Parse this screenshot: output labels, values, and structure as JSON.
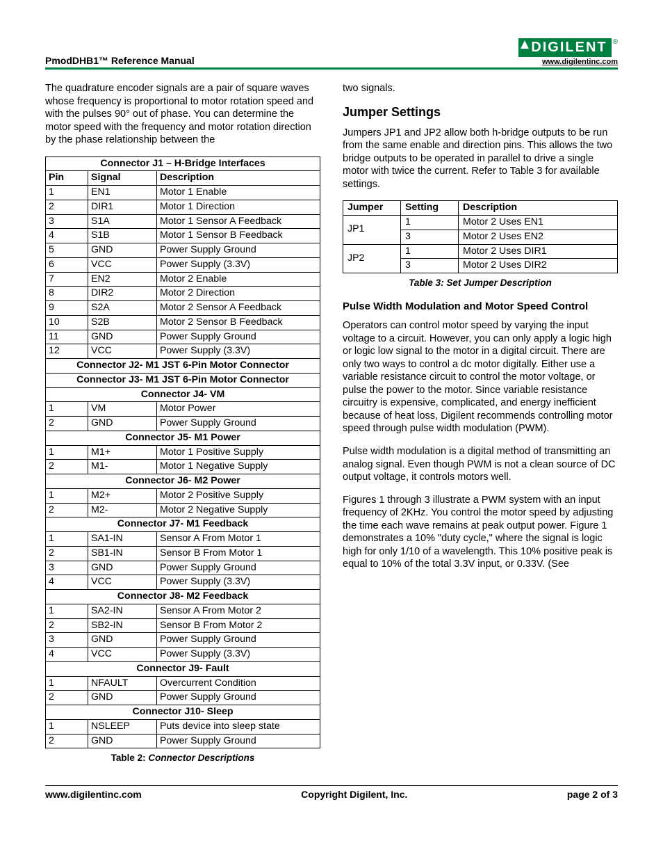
{
  "header": {
    "title": "PmodDHB1™ Reference Manual",
    "logo_text": "DIGILENT",
    "logo_url": "www.digilentinc.com"
  },
  "left": {
    "intro": "The quadrature encoder signals are a pair of square waves whose frequency is proportional to motor rotation speed and with the pulses 90° out of phase. You can determine the motor speed with the frequency and motor rotation direction by the phase relationship between the",
    "table2_caption_b": "Table 2:",
    "table2_caption_i": "Connector Descriptions",
    "tbl": {
      "j1_title": "Connector J1 – H-Bridge Interfaces",
      "hdr_pin": "Pin",
      "hdr_sig": "Signal",
      "hdr_desc": "Description",
      "j1": [
        {
          "p": "1",
          "s": "EN1",
          "d": "Motor 1 Enable"
        },
        {
          "p": "2",
          "s": "DIR1",
          "d": "Motor 1 Direction"
        },
        {
          "p": "3",
          "s": "S1A",
          "d": "Motor 1 Sensor A Feedback"
        },
        {
          "p": "4",
          "s": "S1B",
          "d": "Motor 1 Sensor B Feedback"
        },
        {
          "p": "5",
          "s": "GND",
          "d": "Power Supply Ground"
        },
        {
          "p": "6",
          "s": "VCC",
          "d": "Power Supply (3.3V)"
        },
        {
          "p": "7",
          "s": "EN2",
          "d": "Motor 2 Enable"
        },
        {
          "p": "8",
          "s": "DIR2",
          "d": "Motor 2 Direction"
        },
        {
          "p": "9",
          "s": "S2A",
          "d": "Motor 2 Sensor A Feedback"
        },
        {
          "p": "10",
          "s": "S2B",
          "d": "Motor 2 Sensor B Feedback"
        },
        {
          "p": "11",
          "s": "GND",
          "d": "Power Supply Ground"
        },
        {
          "p": "12",
          "s": "VCC",
          "d": "Power Supply (3.3V)"
        }
      ],
      "j2_title": "Connector J2- M1 JST 6-Pin Motor Connector",
      "j3_title": "Connector J3- M1 JST 6-Pin Motor Connector",
      "j4_title": "Connector J4- VM",
      "j4": [
        {
          "p": "1",
          "s": "VM",
          "d": "Motor Power"
        },
        {
          "p": "2",
          "s": "GND",
          "d": "Power Supply Ground"
        }
      ],
      "j5_title": "Connector J5- M1 Power",
      "j5": [
        {
          "p": "1",
          "s": "M1+",
          "d": "Motor 1 Positive Supply"
        },
        {
          "p": "2",
          "s": "M1-",
          "d": "Motor 1 Negative Supply"
        }
      ],
      "j6_title": "Connector J6- M2 Power",
      "j6": [
        {
          "p": "1",
          "s": "M2+",
          "d": "Motor 2 Positive Supply"
        },
        {
          "p": "2",
          "s": "M2-",
          "d": "Motor 2 Negative Supply"
        }
      ],
      "j7_title": "Connector J7- M1 Feedback",
      "j7": [
        {
          "p": "1",
          "s": "SA1-IN",
          "d": "Sensor A From Motor 1"
        },
        {
          "p": "2",
          "s": "SB1-IN",
          "d": "Sensor B From Motor 1"
        },
        {
          "p": "3",
          "s": "GND",
          "d": "Power Supply Ground"
        },
        {
          "p": "4",
          "s": "VCC",
          "d": "Power Supply (3.3V)"
        }
      ],
      "j8_title": "Connector J8- M2 Feedback",
      "j8": [
        {
          "p": "1",
          "s": "SA2-IN",
          "d": "Sensor A From Motor 2"
        },
        {
          "p": "2",
          "s": "SB2-IN",
          "d": "Sensor B From Motor 2"
        },
        {
          "p": "3",
          "s": "GND",
          "d": "Power Supply Ground"
        },
        {
          "p": "4",
          "s": "VCC",
          "d": "Power Supply (3.3V)"
        }
      ],
      "j9_title": "Connector J9- Fault",
      "j9": [
        {
          "p": "1",
          "s": "NFAULT",
          "d": "Overcurrent Condition"
        },
        {
          "p": "2",
          "s": "GND",
          "d": "Power Supply Ground"
        }
      ],
      "j10_title": "Connector J10- Sleep",
      "j10": [
        {
          "p": "1",
          "s": "NSLEEP",
          "d": "Puts device into sleep state"
        },
        {
          "p": "2",
          "s": "GND",
          "d": "Power Supply Ground"
        }
      ]
    }
  },
  "right": {
    "cont": "two signals.",
    "h_jumper": "Jumper Settings",
    "p_jumper": "Jumpers JP1 and JP2 allow both h-bridge outputs to be run from the same enable and direction pins.  This allows the two bridge outputs to be operated in parallel to drive a single motor with twice the current. Refer to Table 3 for available settings.",
    "jtbl": {
      "h_j": "Jumper",
      "h_s": "Setting",
      "h_d": "Description",
      "rows": [
        {
          "j": "JP1",
          "s": "1",
          "d": "Motor 2 Uses EN1"
        },
        {
          "j": "",
          "s": "3",
          "d": "Motor 2 Uses EN2"
        },
        {
          "j": "JP2",
          "s": "1",
          "d": "Motor 2 Uses DIR1"
        },
        {
          "j": "",
          "s": "3",
          "d": "Motor 2 Uses DIR2"
        }
      ]
    },
    "table3_caption": "Table 3: Set Jumper Description",
    "h_pwm": "Pulse Width Modulation and Motor Speed Control",
    "p_pwm1": "Operators can control motor speed by varying the input voltage to a circuit.  However, you can only apply a logic high or logic low signal to the motor in a digital circuit.  There are only two ways to control a dc motor digitally. Either use a variable resistance circuit to control the motor voltage, or pulse the power to the motor. Since variable resistance circuitry is expensive, complicated, and energy inefficient because of heat loss, Digilent recommends controlling motor speed through pulse width modulation (PWM).",
    "p_pwm2": "Pulse width modulation is a digital method of transmitting an analog signal.  Even though PWM is not a clean source of DC output voltage, it controls motors well.",
    "p_pwm3": "Figures 1 through 3 illustrate a PWM system with an input frequency of 2KHz. You control the motor speed by adjusting the time each wave remains at peak output power. Figure 1 demonstrates a 10% \"duty cycle,\" where the signal is logic high for only 1/10 of a wavelength. This 10% positive peak is equal to 10% of the total 3.3V input, or 0.33V. (See"
  },
  "footer": {
    "url": "www.digilentinc.com",
    "copy": "Copyright Digilent, Inc.",
    "page": "page 2 of 3"
  }
}
